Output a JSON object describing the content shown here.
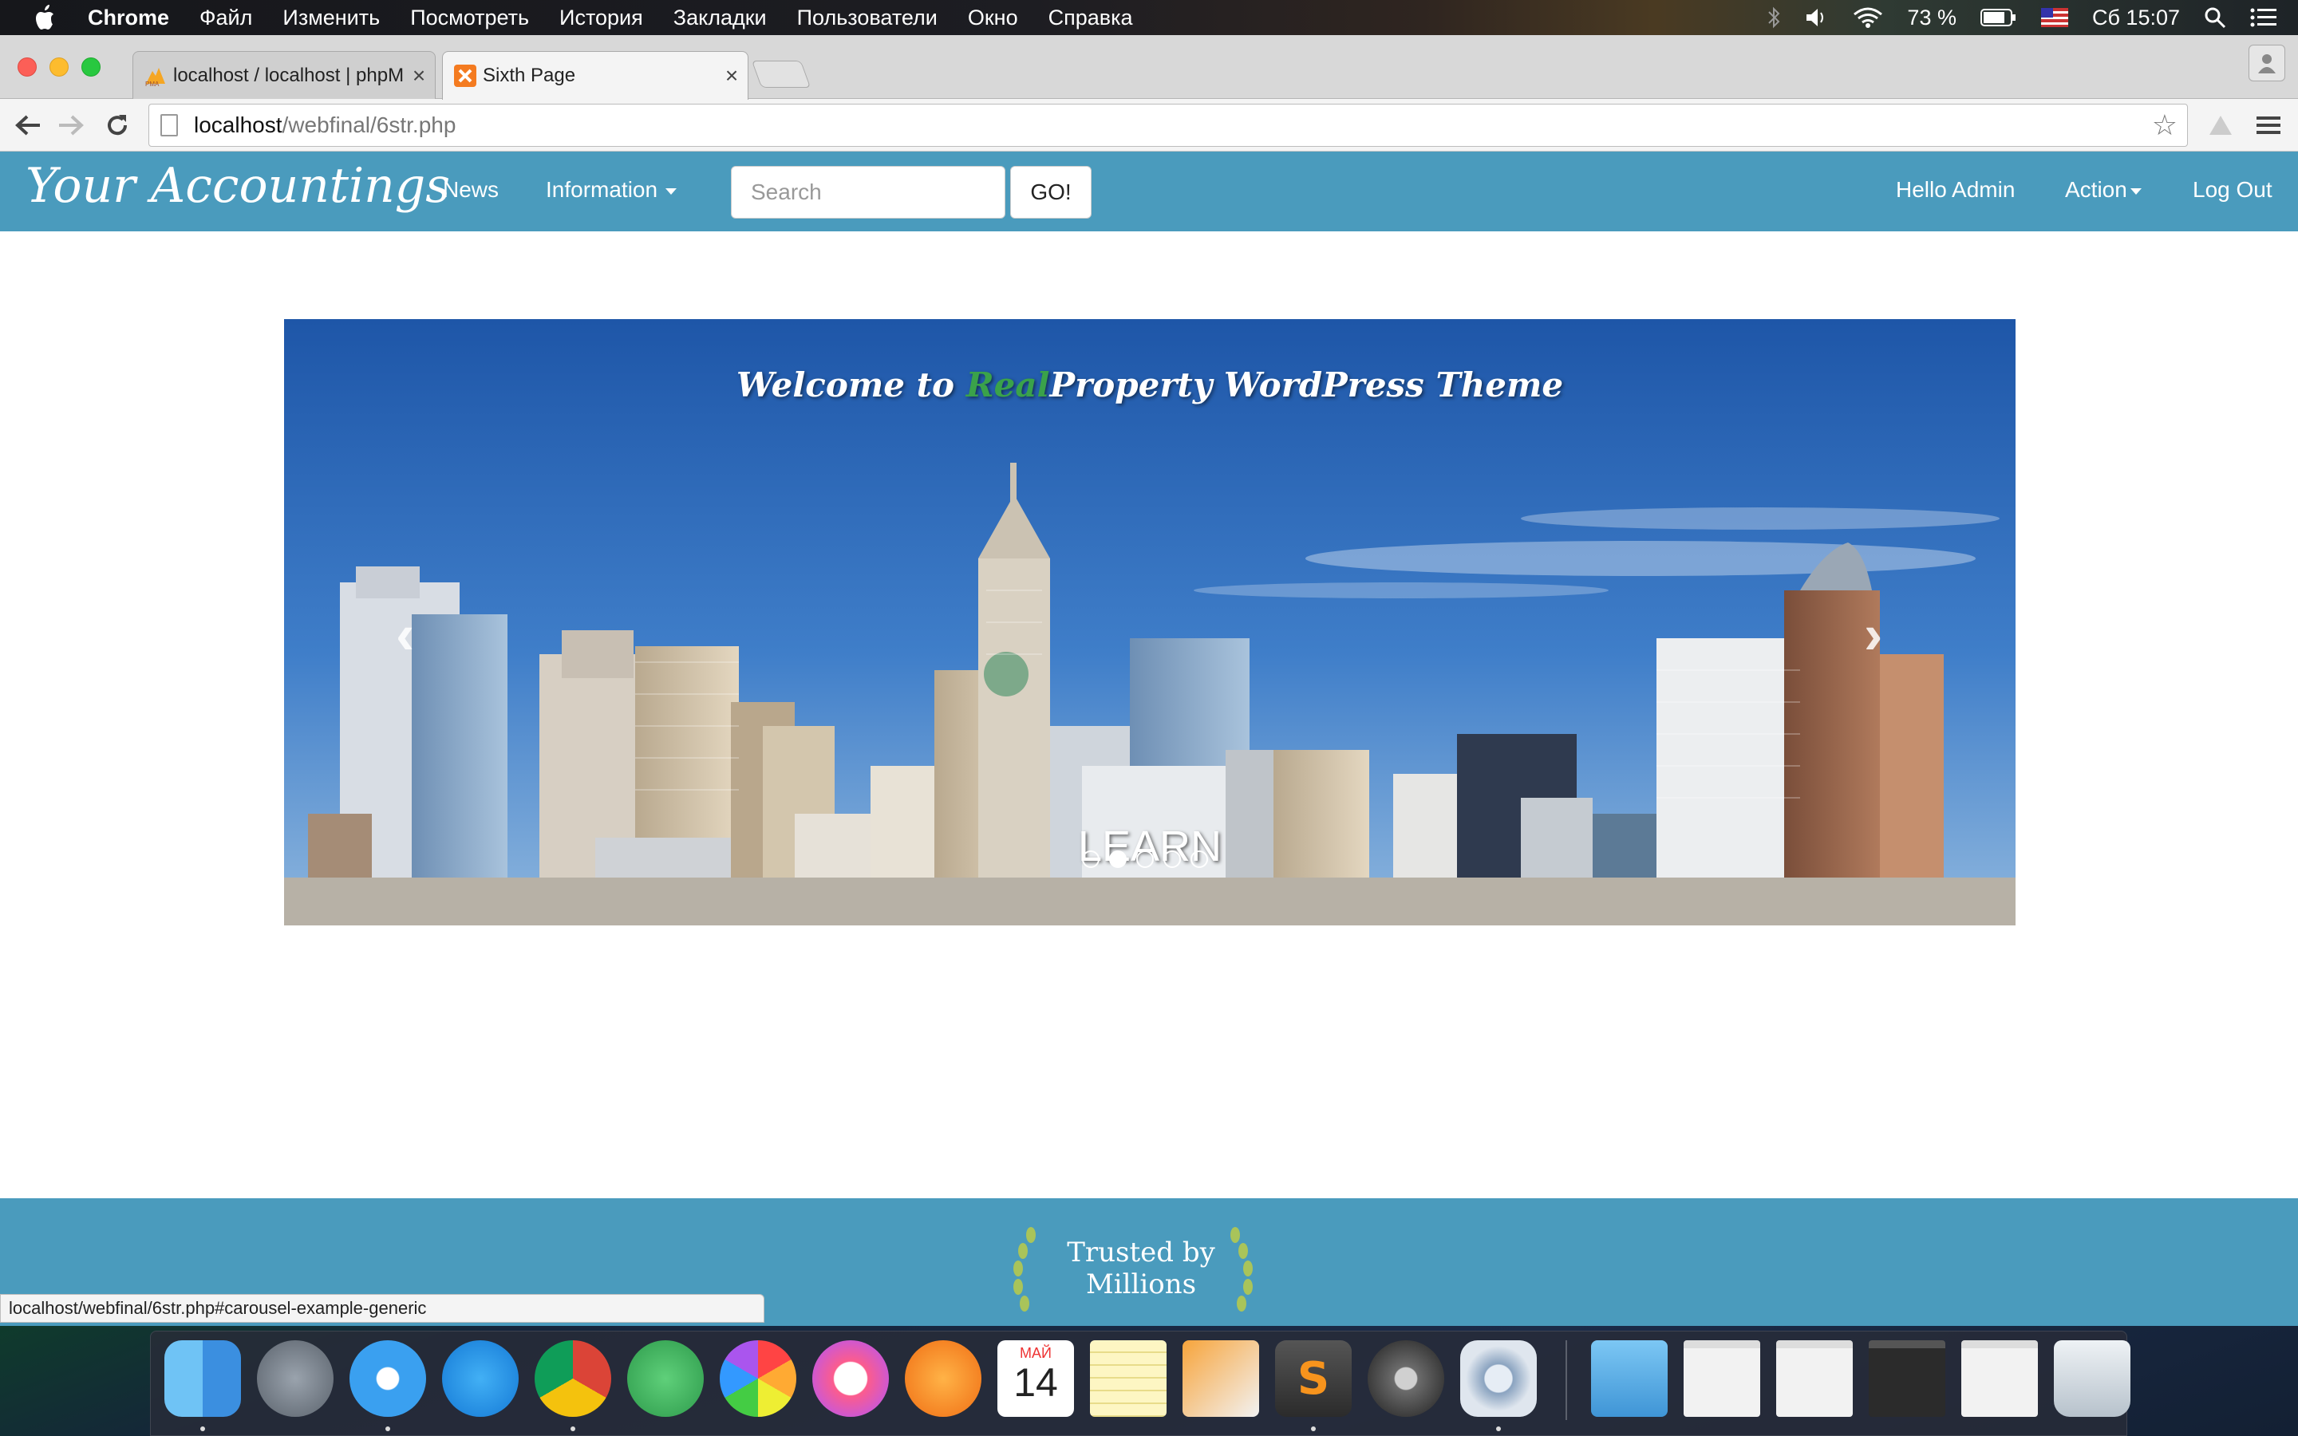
{
  "menubar": {
    "app_name": "Chrome",
    "items": [
      "Файл",
      "Изменить",
      "Посмотреть",
      "История",
      "Закладки",
      "Пользователи",
      "Окно",
      "Справка"
    ],
    "battery": "73 %",
    "clock": "Сб 15:07"
  },
  "browser": {
    "tabs": [
      {
        "title": "localhost / localhost | phpMyAdmin",
        "active": false
      },
      {
        "title": "Sixth Page",
        "active": true
      }
    ],
    "url_host": "localhost",
    "url_path": "/webfinal/6str.php",
    "status_url": "localhost/webfinal/6str.php#carousel-example-generic"
  },
  "site": {
    "brand": "Your Accountings",
    "nav": {
      "news": "News",
      "information": "Information",
      "hello": "Hello Admin",
      "action": "Action",
      "logout": "Log Out"
    },
    "search": {
      "placeholder": "Search",
      "button": "GO!"
    },
    "carousel": {
      "title_before": "Welcome to ",
      "title_accent": "Real",
      "title_after": "Property WordPress Theme",
      "caption": "LEARN",
      "prev": "‹",
      "next": "›",
      "slide_count": 5,
      "active_slide": 2
    },
    "footer": {
      "trusted_line1": "Trusted by",
      "trusted_line2": "Millions"
    }
  },
  "dock": {
    "calendar_month": "МАЙ",
    "calendar_day": "14"
  },
  "colors": {
    "nav_bg": "#4a9bbd",
    "accent_green": "#3aa24a"
  }
}
